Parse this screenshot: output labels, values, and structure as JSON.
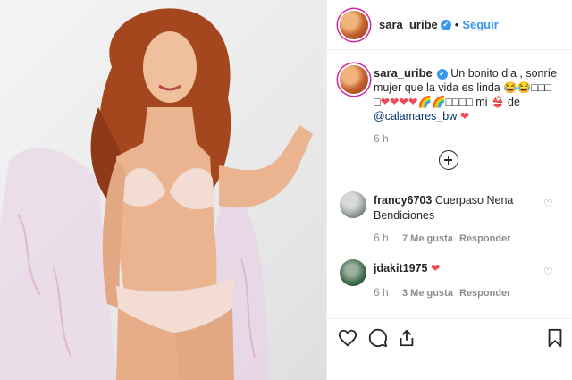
{
  "post_author": {
    "username": "sara_uribe",
    "follow_label": "Seguir",
    "separator": "•"
  },
  "caption": {
    "username": "sara_uribe",
    "text_line1": "Un bonito dia , sonríe mujer que la vida es linda",
    "emoji_row1": "😂😂",
    "emoji_row1b": "□□□",
    "emoji_row2a": "□",
    "emoji_row2_hearts": "❤❤❤❤",
    "emoji_row2_flags": "🌈🌈",
    "emoji_row2_boxes": "□□□□",
    "text_mi": "mi",
    "emoji_tail": "👙",
    "text_de": "de",
    "mention": "@calamares_bw",
    "heart_end": "❤",
    "time": "6 h"
  },
  "comments": [
    {
      "username": "francy6703",
      "text": "Cuerpaso Nena Bendiciones",
      "time": "6 h",
      "likes": "7 Me gusta",
      "reply": "Responder"
    },
    {
      "username": "jdakit1975",
      "text": "❤",
      "time": "6 h",
      "likes": "3 Me gusta",
      "reply": "Responder"
    }
  ],
  "icons": {
    "like": "heart-outline-icon",
    "comment": "comment-icon",
    "share": "share-icon",
    "save": "bookmark-icon",
    "load_more": "plus-circle-icon"
  },
  "colors": {
    "link": "#3897f0",
    "heart": "#ed4956",
    "muted": "#8e8e8e"
  }
}
